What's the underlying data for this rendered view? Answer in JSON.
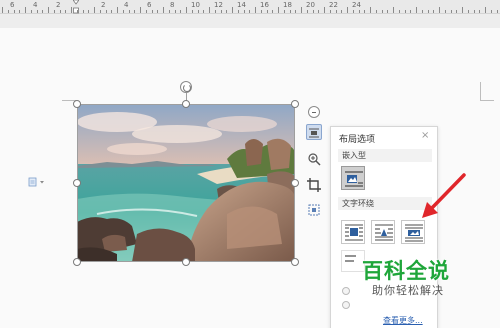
{
  "ruler": {
    "numbers": [
      "6",
      "4",
      "2",
      "2",
      "4",
      "6",
      "8",
      "10",
      "12",
      "14",
      "16",
      "18",
      "20",
      "22",
      "24"
    ]
  },
  "image": {
    "description_icon": "landscape-photo"
  },
  "popup": {
    "title": "布局选项",
    "close_symbol": "×",
    "section_inline": "嵌入型",
    "section_wrap": "文字环绕",
    "more_link": "查看更多...",
    "selected_option": "inline"
  },
  "side_toolbar": {
    "icons": [
      "layout-options-icon",
      "zoom-icon",
      "crop-icon",
      "picture-frame-icon"
    ]
  },
  "watermark": {
    "title": "百科全说",
    "subtitle": "助你轻松解决"
  },
  "colors": {
    "arrow": "#e0262b",
    "watermark_green": "#1fa63a",
    "link_blue": "#2a5fb0"
  }
}
